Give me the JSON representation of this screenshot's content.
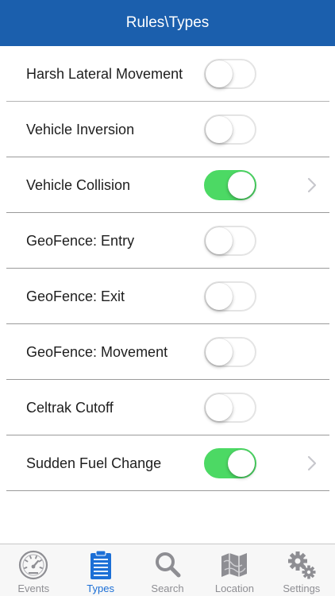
{
  "header": {
    "title": "Rules\\Types"
  },
  "rules": [
    {
      "label": "Harsh Lateral Movement",
      "enabled": false,
      "has_detail": false
    },
    {
      "label": "Vehicle Inversion",
      "enabled": false,
      "has_detail": false
    },
    {
      "label": "Vehicle Collision",
      "enabled": true,
      "has_detail": true
    },
    {
      "label": "GeoFence: Entry",
      "enabled": false,
      "has_detail": false
    },
    {
      "label": "GeoFence: Exit",
      "enabled": false,
      "has_detail": false
    },
    {
      "label": "GeoFence: Movement",
      "enabled": false,
      "has_detail": false
    },
    {
      "label": "Celtrak Cutoff",
      "enabled": false,
      "has_detail": false
    },
    {
      "label": "Sudden Fuel Change",
      "enabled": true,
      "has_detail": true
    }
  ],
  "tabbar": {
    "active": "Types",
    "tabs": [
      {
        "label": "Events",
        "icon": "speedometer-icon"
      },
      {
        "label": "Types",
        "icon": "clipboard-icon"
      },
      {
        "label": "Search",
        "icon": "search-icon"
      },
      {
        "label": "Location",
        "icon": "map-icon"
      },
      {
        "label": "Settings",
        "icon": "gear-icon"
      }
    ]
  },
  "colors": {
    "header_bg": "#1b5fad",
    "toggle_on": "#4cd964",
    "tab_active": "#1c6fd6",
    "tab_inactive": "#8e8e93"
  }
}
